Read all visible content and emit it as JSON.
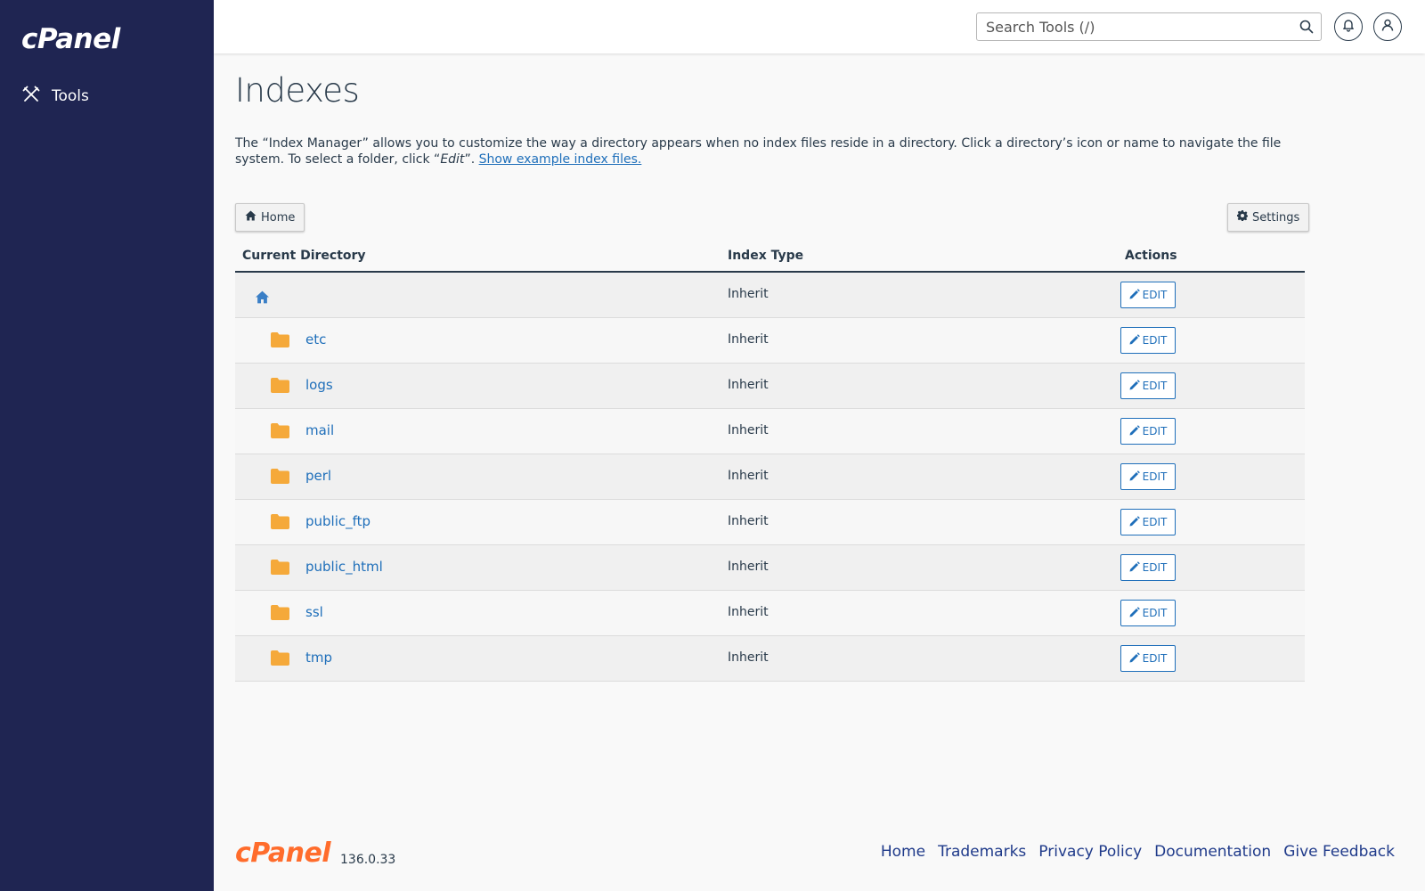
{
  "sidebar": {
    "logo_text": "cPanel",
    "items": [
      {
        "label": "Tools",
        "icon": "tools-icon"
      }
    ]
  },
  "topbar": {
    "search_placeholder": "Search Tools (/)",
    "icons": [
      "search-icon",
      "bell-icon",
      "user-icon"
    ]
  },
  "page": {
    "title": "Indexes",
    "description_before": "The “Index Manager” allows you to customize the way a directory appears when no index files reside in a directory. Click a directory’s icon or name to navigate the file system. To select a folder, click “",
    "description_em": "Edit",
    "description_after": "”. ",
    "description_link": "Show example index files."
  },
  "toolbar": {
    "home_label": "Home",
    "settings_label": "Settings"
  },
  "table": {
    "headers": [
      "Current Directory",
      "Index Type",
      "Actions"
    ],
    "edit_label": "EDIT",
    "root_type": "Inherit",
    "rows": [
      {
        "name": "etc",
        "type": "Inherit"
      },
      {
        "name": "logs",
        "type": "Inherit"
      },
      {
        "name": "mail",
        "type": "Inherit"
      },
      {
        "name": "perl",
        "type": "Inherit"
      },
      {
        "name": "public_ftp",
        "type": "Inherit"
      },
      {
        "name": "public_html",
        "type": "Inherit"
      },
      {
        "name": "ssl",
        "type": "Inherit"
      },
      {
        "name": "tmp",
        "type": "Inherit"
      }
    ]
  },
  "footer": {
    "logo_text": "cPanel",
    "version": "136.0.33",
    "links": [
      "Home",
      "Trademarks",
      "Privacy Policy",
      "Documentation",
      "Give Feedback"
    ]
  },
  "colors": {
    "sidebar_bg": "#1f2552",
    "link_blue": "#1f6fba",
    "folder_orange": "#f5a93a",
    "brand_orange": "#ff6c2c"
  }
}
